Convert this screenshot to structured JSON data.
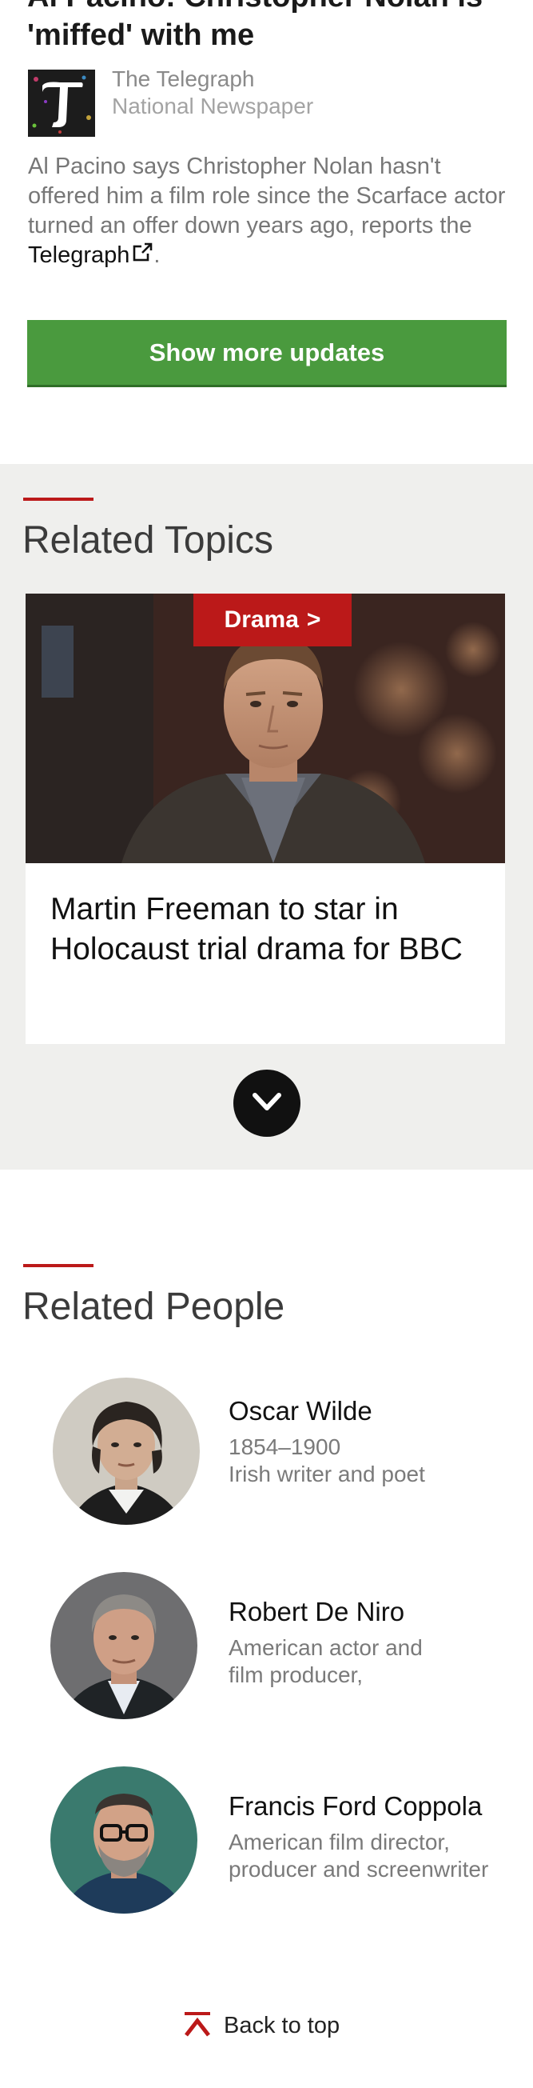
{
  "article": {
    "title": "Al Pacino: Christopher Nolan is 'miffed' with me",
    "source_name": "The Telegraph",
    "source_description": "National Newspaper",
    "summary_text": "Al Pacino says Christopher Nolan hasn't offered him a film role since the Scarface actor turned an offer down years ago, reports the ",
    "summary_link": "Telegraph",
    "summary_end": ".",
    "external_link_icon": "external-link-icon"
  },
  "show_more": {
    "label": "Show more updates",
    "color": "#4a9a3e"
  },
  "related_topics": {
    "heading": "Related Topics",
    "accent_color": "#bb1919",
    "background": "#efefed",
    "card": {
      "tag": "Drama",
      "tag_arrow": ">",
      "headline": "Martin Freeman to star in Holocaust trial drama for BBC"
    },
    "expand_icon": "chevron-down-icon"
  },
  "related_people": {
    "heading": "Related People",
    "people": [
      {
        "name": "Oscar Wilde",
        "dates": "1854–1900",
        "description": "Irish writer and poet"
      },
      {
        "name": "Robert De Niro",
        "description_line1": "American actor and",
        "description_line2": "film producer,"
      },
      {
        "name": "Francis Ford Coppola",
        "description_line1": "American film director,",
        "description_line2": "producer and screenwriter"
      }
    ]
  },
  "footer": {
    "back_to_top": "Back to top",
    "icon": "arrow-up-icon",
    "accent_color": "#bb1919"
  }
}
